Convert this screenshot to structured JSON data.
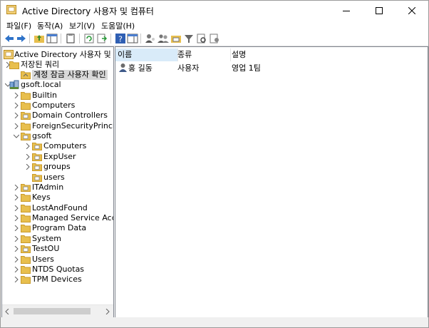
{
  "window": {
    "title": "Active Directory 사용자 및 컴퓨터"
  },
  "menu": [
    "파일(F)",
    "동작(A)",
    "보기(V)",
    "도움말(H)"
  ],
  "tree": {
    "root": "Active Directory 사용자 및 컴퓨터",
    "saved_queries": "저장된 쿼리",
    "saved_query_child": "계정 잠금 사용자 확인",
    "domain": "gsoft.local",
    "ou": {
      "builtin": "Builtin",
      "computers": "Computers",
      "domain_controllers": "Domain Controllers",
      "fsp": "ForeignSecurityPrincipals",
      "gsoft": "gsoft",
      "gsoft_computers": "Computers",
      "gsoft_expuser": "ExpUser",
      "gsoft_groups": "groups",
      "gsoft_users": "users",
      "itadmin": "ITAdmin",
      "keys": "Keys",
      "lostandfound": "LostAndFound",
      "msa": "Managed Service Account",
      "program_data": "Program Data",
      "system": "System",
      "testou": "TestOU",
      "users": "Users",
      "ntds_quotas": "NTDS Quotas",
      "tpm_devices": "TPM Devices"
    }
  },
  "list": {
    "columns": {
      "name": "이름",
      "type": "종류",
      "desc": "설명"
    },
    "rows": [
      {
        "name": "홍 길동",
        "type": "사용자",
        "desc": "영업 1팀"
      }
    ]
  },
  "colors": {
    "selection": "#d9d9d9",
    "header_active": "#d9ebf9",
    "folder": "#e8bf4e"
  }
}
